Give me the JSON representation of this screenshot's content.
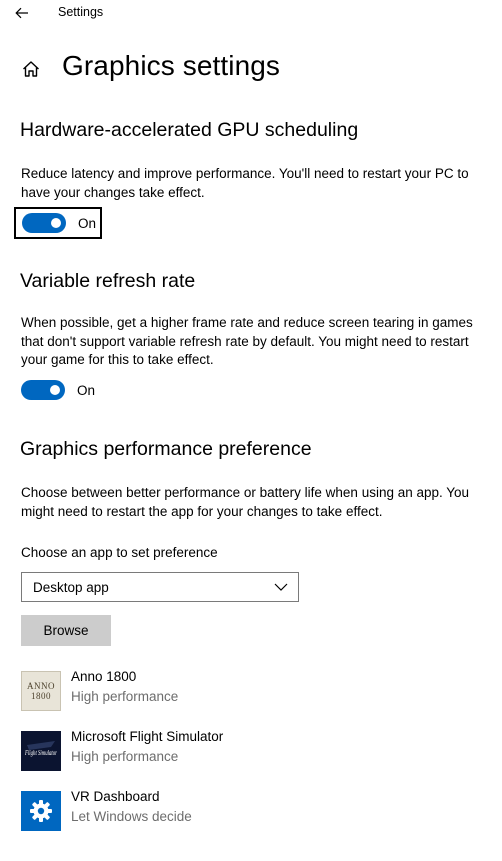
{
  "window": {
    "title": "Settings"
  },
  "header": {
    "page_title": "Graphics settings"
  },
  "gpu_scheduling": {
    "title": "Hardware-accelerated GPU scheduling",
    "description": "Reduce latency and improve performance. You'll need to restart your PC to have your changes take effect.",
    "toggle_label": "On",
    "state": true
  },
  "variable_refresh": {
    "title": "Variable refresh rate",
    "description": "When possible, get a higher frame rate and reduce screen tearing in games that don't support variable refresh rate by default. You might need to restart your game for this to take effect.",
    "toggle_label": "On",
    "state": true
  },
  "performance_pref": {
    "title": "Graphics performance preference",
    "description": "Choose between better performance or battery life when using an app. You might need to restart the app for your changes to take effect.",
    "choose_label": "Choose an app to set preference",
    "dropdown_value": "Desktop app",
    "browse_label": "Browse",
    "apps": [
      {
        "name": "Anno 1800",
        "preference": "High performance",
        "icon": "anno-1800-icon",
        "icon_text": "ANNO 1800"
      },
      {
        "name": "Microsoft Flight Simulator",
        "preference": "High performance",
        "icon": "flight-simulator-icon",
        "icon_text": "Flight Simulator"
      },
      {
        "name": "VR Dashboard",
        "preference": "Let Windows decide",
        "icon": "gear-icon"
      }
    ]
  },
  "colors": {
    "accent": "#0067c0",
    "secondary_text": "#6d6d6d",
    "button_bg": "#cccccc"
  }
}
